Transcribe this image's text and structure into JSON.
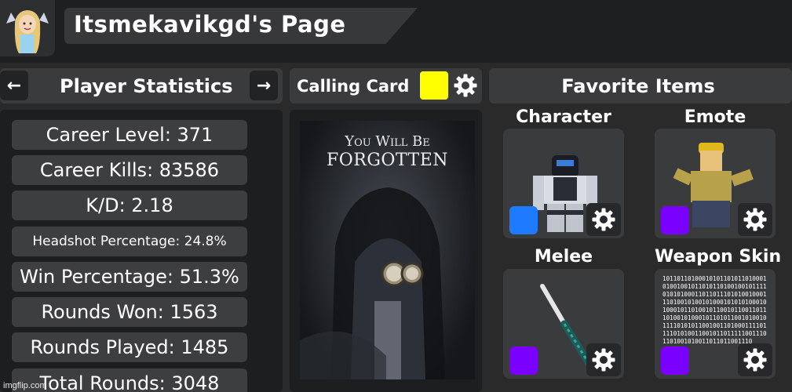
{
  "page": {
    "title": "Itsmekavikgd's Page"
  },
  "statistics": {
    "header": "Player Statistics",
    "prev_arrow": "←",
    "next_arrow": "→",
    "rows": [
      "Career Level: 371",
      "Career Kills: 83586",
      "K/D: 2.18",
      "Headshot Percentage: 24.8%",
      "Win Percentage: 51.3%",
      "Rounds Won: 1563",
      "Rounds Played: 1485",
      "Total Rounds: 3048"
    ]
  },
  "calling_card": {
    "label": "Calling Card",
    "swatch_color": "#FFFF00",
    "art_line1": "You Will Be",
    "art_line2": "FORGOTTEN"
  },
  "favorites": {
    "header": "Favorite Items",
    "items": [
      {
        "label": "Character",
        "swatch_color": "#1E7BFF",
        "icon": "character-avatar"
      },
      {
        "label": "Emote",
        "swatch_color": "#7A00FF",
        "icon": "emote-avatar"
      },
      {
        "label": "Melee",
        "swatch_color": "#7A00FF",
        "icon": "butterfly-knife"
      },
      {
        "label": "Weapon Skin",
        "swatch_color": "#7A00FF",
        "icon": "binary-code-skin"
      }
    ],
    "binary_text": "10110110100010101101011010001010010010110101101001001011110101010001101101110101001000111010010100101000101010100010100010110100101100101100110111010010100010110101100101001011110101011001001101000111101111010100110010110111110011101101001010011011011001110"
  },
  "watermark": "imgflip.com",
  "icons": {
    "settings": "gear-icon",
    "avatar": "player-avatar"
  }
}
